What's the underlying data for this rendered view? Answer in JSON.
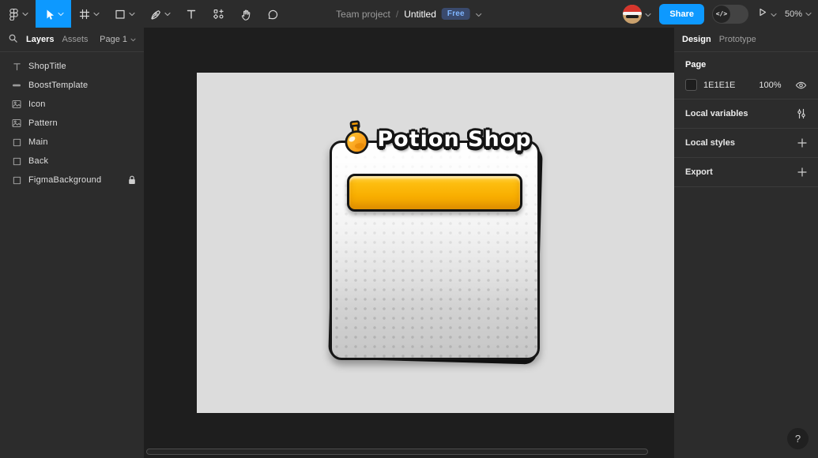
{
  "toolbar": {
    "breadcrumb": {
      "project": "Team project",
      "separator": "/",
      "file": "Untitled",
      "badge": "Free"
    },
    "share_label": "Share",
    "dev_toggle_glyph": "</>",
    "zoom_level": "50%"
  },
  "left_panel": {
    "tabs": [
      {
        "label": "Layers"
      },
      {
        "label": "Assets"
      }
    ],
    "page_selector": "Page 1",
    "layers": [
      {
        "name": "ShopTitle",
        "icon": "text-layer-icon",
        "locked": false
      },
      {
        "name": "BoostTemplate",
        "icon": "line-layer-icon",
        "locked": false
      },
      {
        "name": "Icon",
        "icon": "image-layer-icon",
        "locked": false
      },
      {
        "name": "Pattern",
        "icon": "image-layer-icon",
        "locked": false
      },
      {
        "name": "Main",
        "icon": "rectangle-layer-icon",
        "locked": false
      },
      {
        "name": "Back",
        "icon": "rectangle-layer-icon",
        "locked": false
      },
      {
        "name": "FigmaBackground",
        "icon": "rectangle-layer-icon",
        "locked": true
      }
    ]
  },
  "right_panel": {
    "tabs": [
      {
        "label": "Design"
      },
      {
        "label": "Prototype"
      }
    ],
    "page_section": {
      "title": "Page",
      "color_hex": "1E1E1E",
      "opacity": "100%"
    },
    "sections": [
      {
        "label": "Local variables",
        "icon": "variables-icon"
      },
      {
        "label": "Local styles",
        "icon": "plus-icon"
      },
      {
        "label": "Export",
        "icon": "plus-icon"
      }
    ],
    "help_label": "?"
  },
  "canvas": {
    "shop_card": {
      "title": "Potion Shop"
    }
  },
  "icons": {
    "figma-menu-icon": "figma logo glyph",
    "move-tool-icon": "cursor arrow",
    "frame-tool-icon": "hash grid",
    "rectangle-tool-icon": "square outline",
    "pen-tool-icon": "pen nib",
    "text-tool-icon": "T",
    "actions-tool-icon": "shape grid with plus",
    "hand-tool-icon": "open hand",
    "comment-tool-icon": "speech bubble",
    "search-icon": "magnifier",
    "lock-icon": "padlock",
    "eye-icon": "eye",
    "variables-icon": "vertical sliders",
    "plus-icon": "+",
    "potion-icon": "round flask with orange liquid"
  },
  "colors": {
    "accent": "#0D99FF",
    "toolbar_bg": "#2C2C2C",
    "canvas_bg": "#1E1E1E",
    "artboard_bg": "#DCDCDC",
    "badge_bg": "#3A4A6D",
    "badge_text": "#7FB5FF",
    "button_yellow_top": "#FFD24A",
    "button_yellow_bottom": "#F2A400",
    "page_swatch": "#1E1E1E"
  }
}
